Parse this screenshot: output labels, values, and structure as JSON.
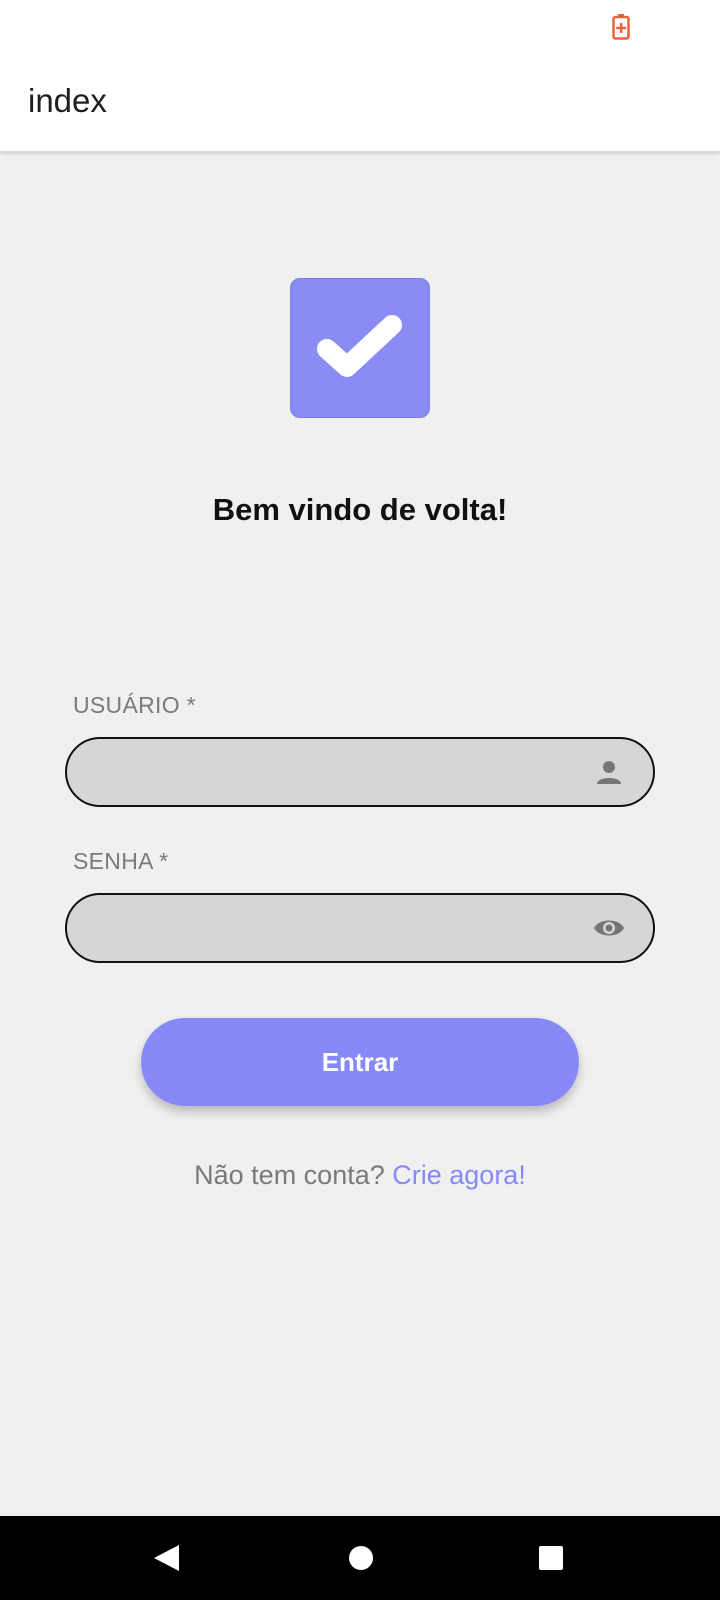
{
  "status_bar": {
    "battery_icon": "battery-charging-icon",
    "battery_color": "#e8623a"
  },
  "app_bar": {
    "title": "index"
  },
  "logo": {
    "icon": "checkmark-icon",
    "color": "#898cf5"
  },
  "welcome": {
    "title": "Bem vindo de volta!"
  },
  "form": {
    "username": {
      "label": "USUÁRIO *",
      "value": "",
      "icon": "person-icon"
    },
    "password": {
      "label": "SENHA *",
      "value": "",
      "icon": "eye-icon"
    },
    "submit_label": "Entrar",
    "accent_color": "#8689f6"
  },
  "signup": {
    "prompt": "Não tem conta?",
    "link_label": "Crie agora!"
  },
  "nav_bar": {
    "back_icon": "back-triangle-icon",
    "home_icon": "home-circle-icon",
    "recents_icon": "recents-square-icon"
  }
}
